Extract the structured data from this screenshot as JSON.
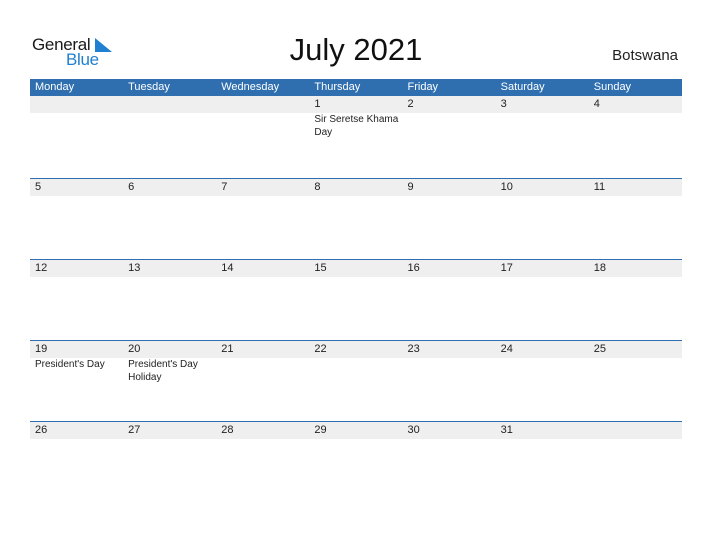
{
  "header": {
    "logo": {
      "word1": "General",
      "word2": "Blue"
    },
    "title": "July 2021",
    "country": "Botswana"
  },
  "colors": {
    "accent": "#2f6fb0",
    "date_strip": "#efefef",
    "logo_blue": "#1f7fd0"
  },
  "weekdays": [
    "Monday",
    "Tuesday",
    "Wednesday",
    "Thursday",
    "Friday",
    "Saturday",
    "Sunday"
  ],
  "weeks": [
    [
      {
        "day": "",
        "holiday": ""
      },
      {
        "day": "",
        "holiday": ""
      },
      {
        "day": "",
        "holiday": ""
      },
      {
        "day": "1",
        "holiday": "Sir Seretse Khama Day"
      },
      {
        "day": "2",
        "holiday": ""
      },
      {
        "day": "3",
        "holiday": ""
      },
      {
        "day": "4",
        "holiday": ""
      }
    ],
    [
      {
        "day": "5",
        "holiday": ""
      },
      {
        "day": "6",
        "holiday": ""
      },
      {
        "day": "7",
        "holiday": ""
      },
      {
        "day": "8",
        "holiday": ""
      },
      {
        "day": "9",
        "holiday": ""
      },
      {
        "day": "10",
        "holiday": ""
      },
      {
        "day": "11",
        "holiday": ""
      }
    ],
    [
      {
        "day": "12",
        "holiday": ""
      },
      {
        "day": "13",
        "holiday": ""
      },
      {
        "day": "14",
        "holiday": ""
      },
      {
        "day": "15",
        "holiday": ""
      },
      {
        "day": "16",
        "holiday": ""
      },
      {
        "day": "17",
        "holiday": ""
      },
      {
        "day": "18",
        "holiday": ""
      }
    ],
    [
      {
        "day": "19",
        "holiday": "President's Day"
      },
      {
        "day": "20",
        "holiday": "President's Day Holiday"
      },
      {
        "day": "21",
        "holiday": ""
      },
      {
        "day": "22",
        "holiday": ""
      },
      {
        "day": "23",
        "holiday": ""
      },
      {
        "day": "24",
        "holiday": ""
      },
      {
        "day": "25",
        "holiday": ""
      }
    ],
    [
      {
        "day": "26",
        "holiday": ""
      },
      {
        "day": "27",
        "holiday": ""
      },
      {
        "day": "28",
        "holiday": ""
      },
      {
        "day": "29",
        "holiday": ""
      },
      {
        "day": "30",
        "holiday": ""
      },
      {
        "day": "31",
        "holiday": ""
      },
      {
        "day": "",
        "holiday": ""
      }
    ]
  ]
}
